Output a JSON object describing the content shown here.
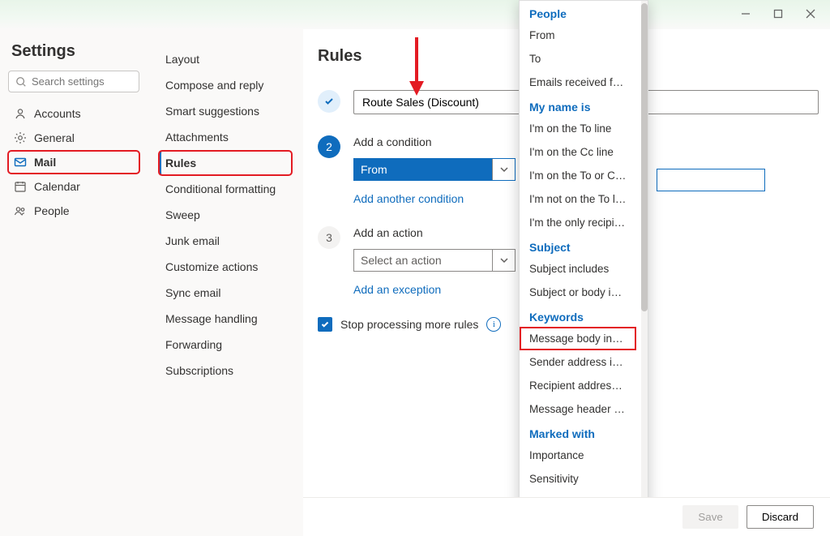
{
  "window": {
    "title": ""
  },
  "settings_title": "Settings",
  "search_placeholder": "Search settings",
  "left_nav": {
    "accounts": "Accounts",
    "general": "General",
    "mail": "Mail",
    "calendar": "Calendar",
    "people": "People"
  },
  "mail_nav": {
    "layout": "Layout",
    "compose": "Compose and reply",
    "smart": "Smart suggestions",
    "attachments": "Attachments",
    "rules": "Rules",
    "condfmt": "Conditional formatting",
    "sweep": "Sweep",
    "junk": "Junk email",
    "custom": "Customize actions",
    "sync": "Sync email",
    "msghandle": "Message handling",
    "forwarding": "Forwarding",
    "subs": "Subscriptions"
  },
  "main": {
    "heading": "Rules",
    "rule_name": "Route Sales (Discount)",
    "step2_title": "Add a condition",
    "step3_title": "Add an action",
    "condition_value": "From",
    "action_placeholder": "Select an action",
    "add_condition": "Add another condition",
    "add_exception": "Add an exception",
    "stop_label": "Stop processing more rules"
  },
  "footer": {
    "save": "Save",
    "discard": "Discard"
  },
  "dropdown": {
    "people_h": "People",
    "from": "From",
    "to": "To",
    "emails_received": "Emails received for ot...",
    "mynameis_h": "My name is",
    "on_to": "I'm on the To line",
    "on_cc": "I'm on the Cc line",
    "on_to_or_cc": "I'm on the To or Cc line",
    "not_on_to": "I'm not on the To line",
    "only_recipient": "I'm the only recipient",
    "subject_h": "Subject",
    "subj_incl": "Subject includes",
    "subj_body_incl": "Subject or body inclu...",
    "keywords_h": "Keywords",
    "msg_body_incl": "Message body includes",
    "sender_addr": "Sender address includ...",
    "recip_addr": "Recipient address incl...",
    "msg_header": "Message header inclu...",
    "marked_h": "Marked with",
    "importance": "Importance",
    "sensitivity": "Sensitivity"
  }
}
